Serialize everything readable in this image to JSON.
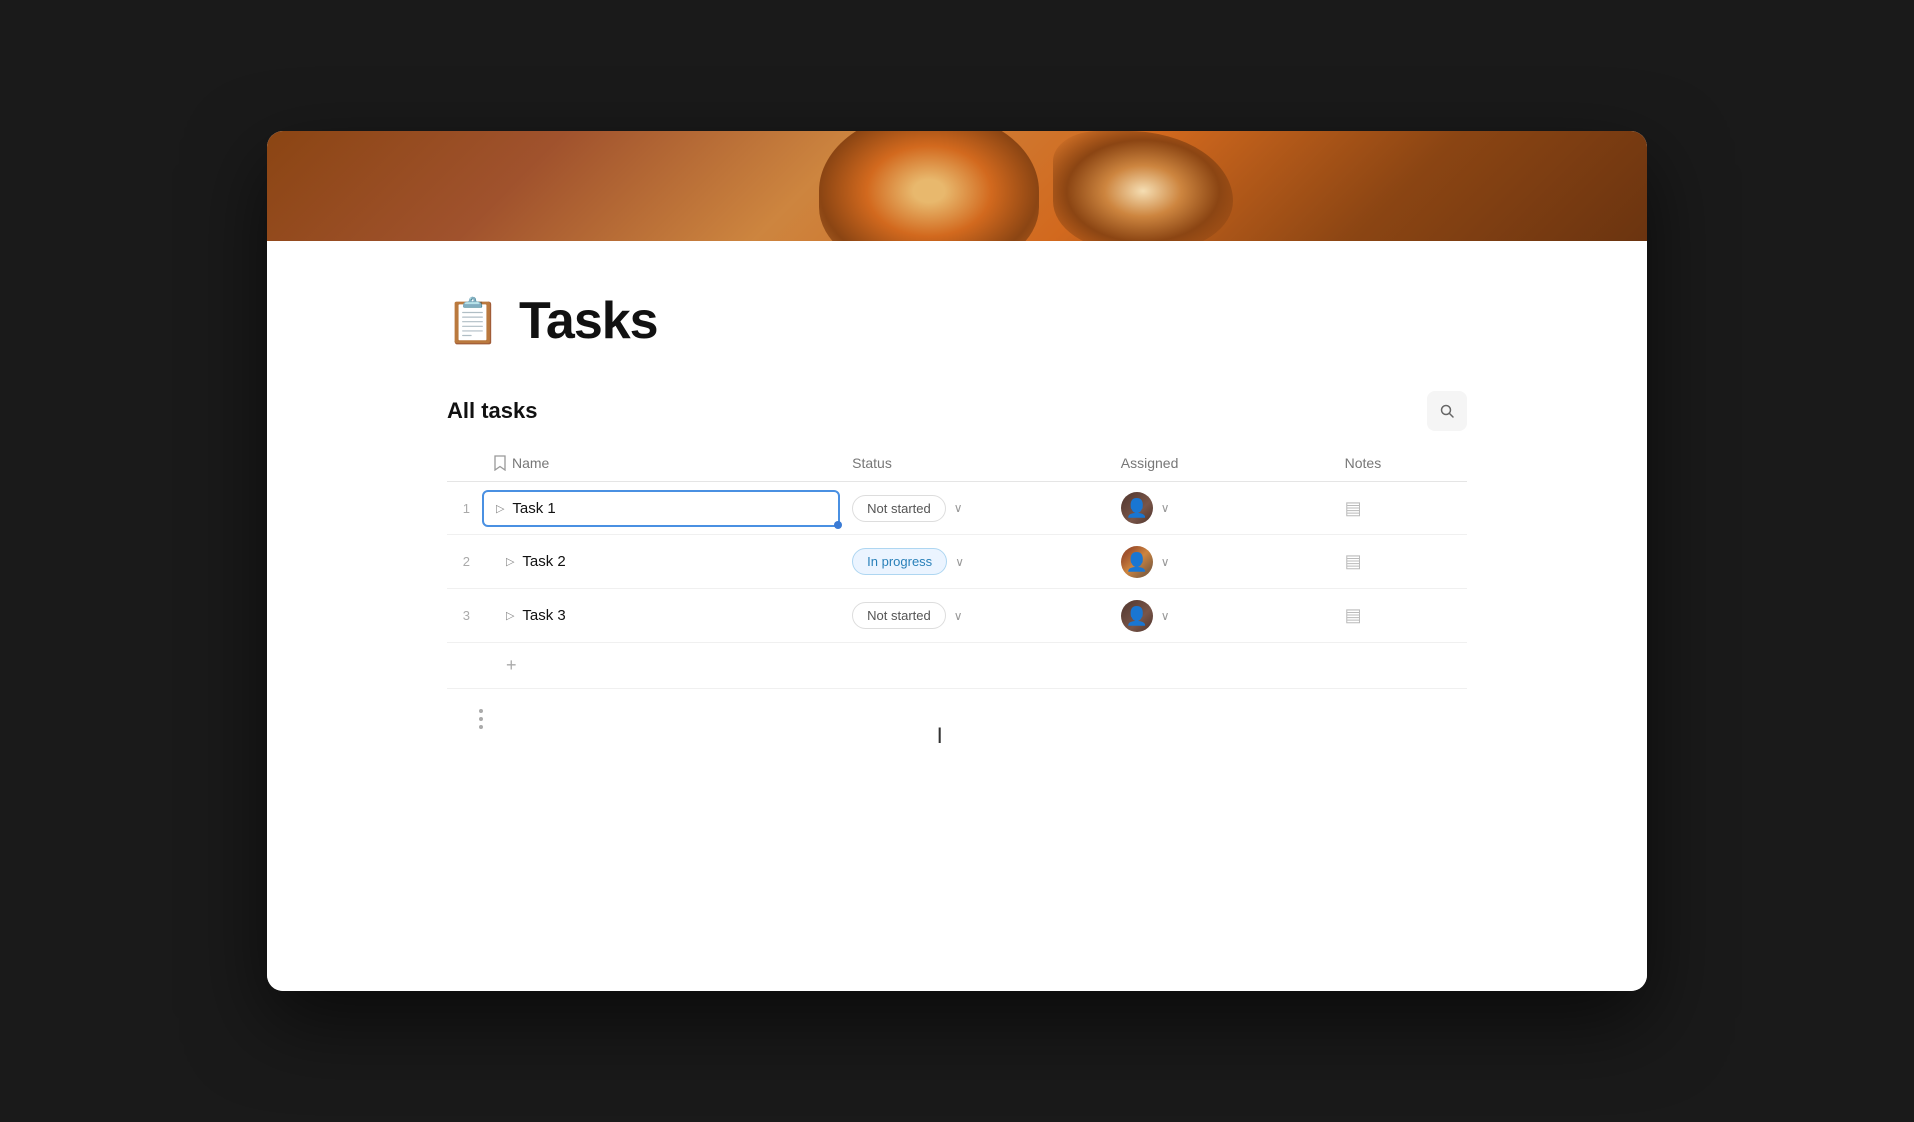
{
  "window": {
    "title": "Tasks"
  },
  "header": {
    "banner_alt": "Dog photo banner"
  },
  "page": {
    "icon": "📋",
    "title": "Tasks",
    "section_title": "All tasks"
  },
  "table": {
    "columns": {
      "name": "Name",
      "status": "Status",
      "assigned": "Assigned",
      "notes": "Notes"
    },
    "rows": [
      {
        "num": "1",
        "name": "Task 1",
        "status": "Not started",
        "status_type": "not-started",
        "notes_icon": "▤"
      },
      {
        "num": "2",
        "name": "Task 2",
        "status": "In progress",
        "status_type": "in-progress",
        "notes_icon": "▤"
      },
      {
        "num": "3",
        "name": "Task 3",
        "status": "Not started",
        "status_type": "not-started",
        "notes_icon": "▤"
      }
    ]
  },
  "toolbar": {
    "search_title": "Search",
    "add_label": "+"
  },
  "dots_menu": "⋮"
}
